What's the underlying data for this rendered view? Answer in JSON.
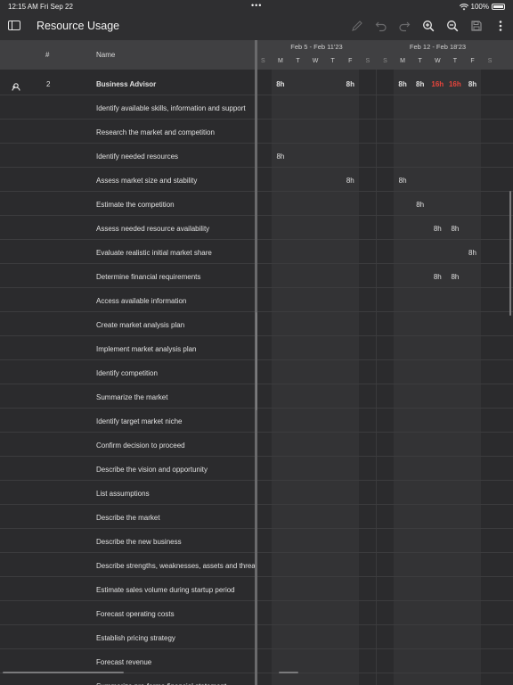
{
  "status": {
    "time": "12:15 AM",
    "date": "Fri Sep 22",
    "battery": "100%"
  },
  "toolbar": {
    "title": "Resource Usage"
  },
  "header": {
    "num": "#",
    "name": "Name"
  },
  "weeks": [
    {
      "label": "Feb 5 - Feb 11'23",
      "days": [
        "S",
        "M",
        "T",
        "W",
        "T",
        "F",
        "S"
      ]
    },
    {
      "label": "Feb 12 - Feb 18'23",
      "days": [
        "S",
        "M",
        "T",
        "W",
        "T",
        "F",
        "S"
      ]
    }
  ],
  "rows": [
    {
      "num": "2",
      "name": "Business Advisor",
      "bold": true,
      "icon": "resource-icon",
      "cells": {
        "1": "8h",
        "5": "8h",
        "8": "8h",
        "9": "8h",
        "10": "16h",
        "11": "16h",
        "12": "8h"
      },
      "over": [
        "10",
        "11"
      ]
    },
    {
      "name": "Identify available skills, information and support",
      "cells": {}
    },
    {
      "name": "Research the market and competition",
      "cells": {}
    },
    {
      "name": "Identify needed resources",
      "cells": {
        "1": "8h"
      }
    },
    {
      "name": "Assess market size and stability",
      "cells": {
        "5": "8h",
        "8": "8h"
      }
    },
    {
      "name": "Estimate the competition",
      "cells": {
        "9": "8h"
      }
    },
    {
      "name": "Assess needed resource availability",
      "cells": {
        "10": "8h",
        "11": "8h"
      }
    },
    {
      "name": "Evaluate realistic initial market share",
      "cells": {
        "12": "8h"
      }
    },
    {
      "name": "Determine financial requirements",
      "cells": {
        "10": "8h",
        "11": "8h"
      }
    },
    {
      "name": "Access available information",
      "cells": {}
    },
    {
      "name": "Create market analysis plan",
      "cells": {}
    },
    {
      "name": "Implement market analysis plan",
      "cells": {}
    },
    {
      "name": "Identify competition",
      "cells": {}
    },
    {
      "name": "Summarize the market",
      "cells": {}
    },
    {
      "name": "Identify target market niche",
      "cells": {}
    },
    {
      "name": "Confirm decision to proceed",
      "cells": {}
    },
    {
      "name": "Describe the vision and opportunity",
      "cells": {}
    },
    {
      "name": "List assumptions",
      "cells": {}
    },
    {
      "name": "Describe the market",
      "cells": {}
    },
    {
      "name": "Describe the new business",
      "cells": {}
    },
    {
      "name": "Describe strengths, weaknesses, assets and threats",
      "cells": {}
    },
    {
      "name": "Estimate sales volume during startup period",
      "cells": {}
    },
    {
      "name": "Forecast operating costs",
      "cells": {}
    },
    {
      "name": "Establish pricing strategy",
      "cells": {}
    },
    {
      "name": "Forecast revenue",
      "cells": {}
    },
    {
      "name": "Summarize pro-forma financial statement",
      "cells": {}
    }
  ],
  "colors": {
    "overallocated": "#e8453c",
    "weekday_bg": "#333335",
    "weekend_bg": "#2b2b2d"
  }
}
